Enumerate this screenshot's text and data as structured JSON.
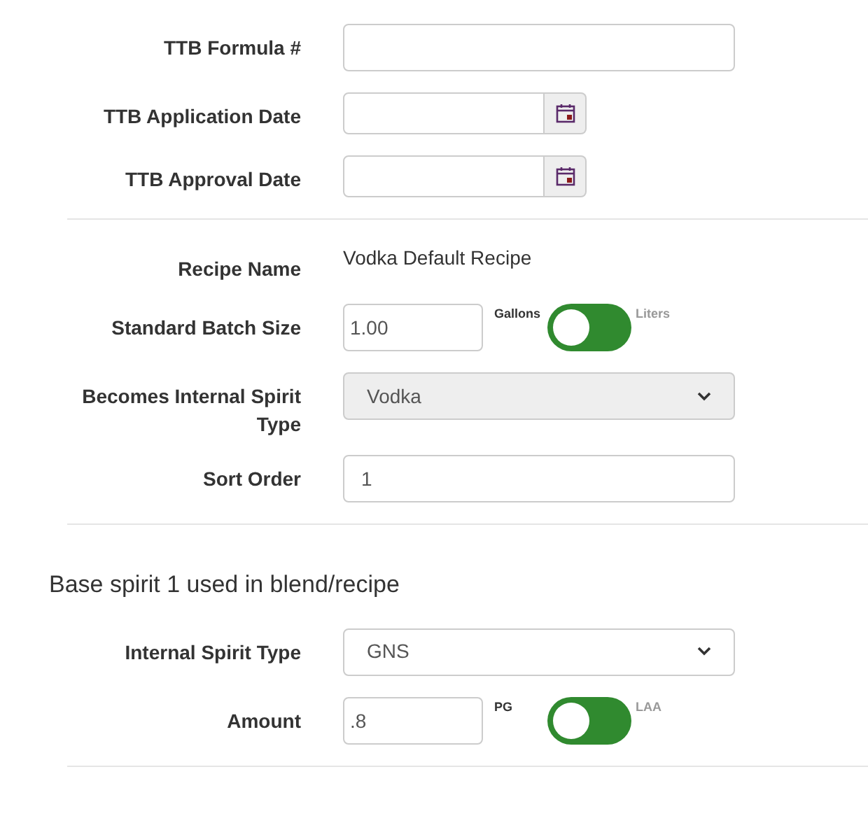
{
  "sections": [
    {
      "rows": [
        {
          "kind": "text",
          "label": "TTB Formula #"
        },
        {
          "kind": "date",
          "label": "TTB Application Date"
        },
        {
          "kind": "date",
          "label": "TTB Approval Date"
        }
      ]
    },
    {
      "rows": [
        {
          "kind": "static",
          "label": "Recipe Name",
          "value": "Vodka Default Recipe"
        },
        {
          "kind": "unit",
          "label": "Standard Batch Size",
          "value": "1.00",
          "toggle": {
            "left": "Gallons",
            "right": "Liters",
            "on": false
          }
        },
        {
          "kind": "select",
          "label": "Becomes Internal Spirit Type",
          "value": "Vodka",
          "disabled": true
        },
        {
          "kind": "text",
          "label": "Sort Order",
          "value": "1"
        }
      ]
    },
    {
      "heading": "Base spirit 1 used in blend/recipe",
      "rows": [
        {
          "kind": "select",
          "label": "Internal Spirit Type",
          "value": "GNS",
          "disabled": false
        },
        {
          "kind": "unit",
          "label": "Amount",
          "value": ".8",
          "toggle": {
            "left": "PG",
            "right": "LAA",
            "on": false
          }
        }
      ]
    }
  ]
}
